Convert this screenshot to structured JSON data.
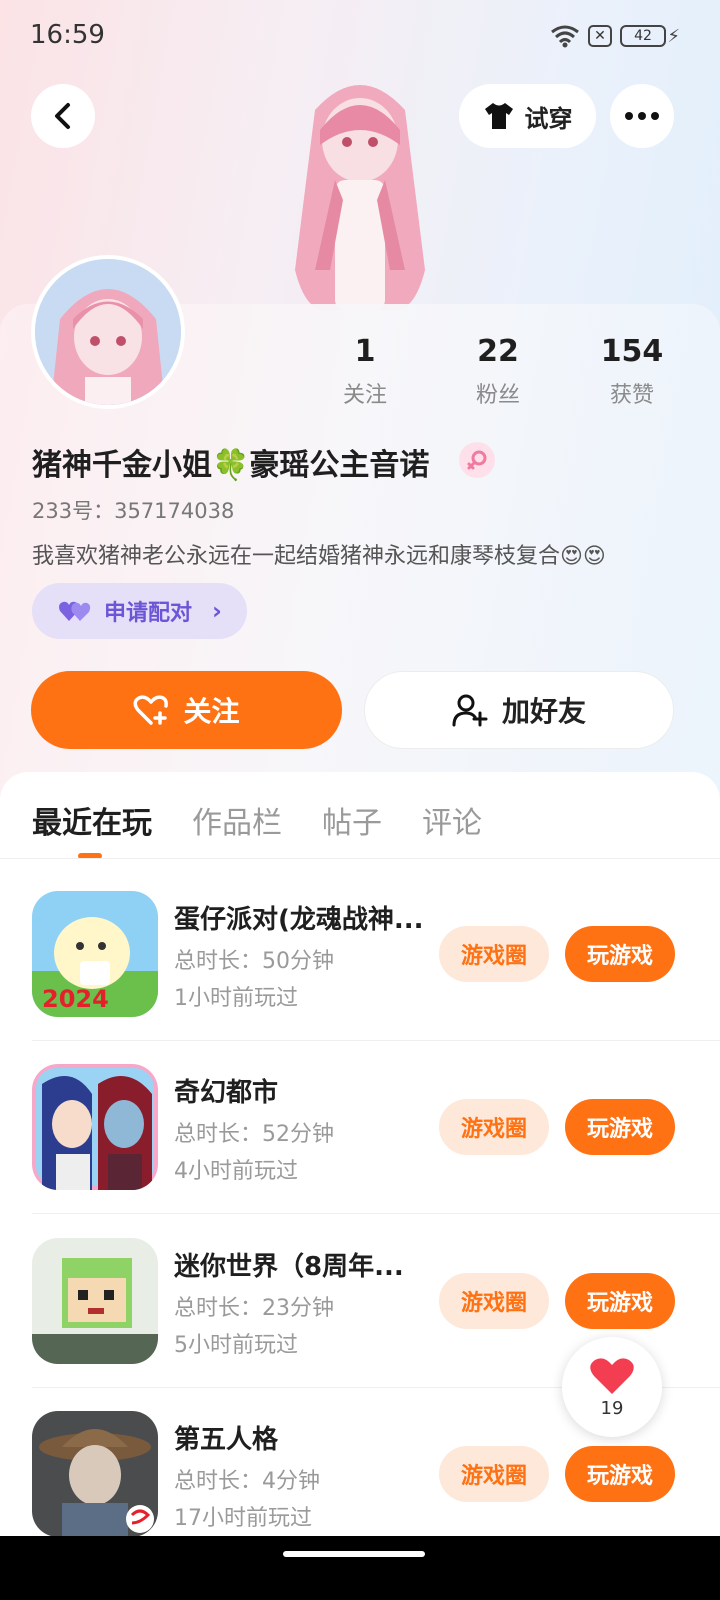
{
  "status_bar": {
    "time": "16:59",
    "battery": "42",
    "battery_alert": "✕"
  },
  "header": {
    "try_on_label": "试穿"
  },
  "profile": {
    "nickname": "猪神千金小姐🍀豪瑶公主音诺",
    "uid": "233号：357174038",
    "bio": "我喜欢猪神老公永远在一起结婚猪神永远和康琴枝复合😍😍",
    "pair_label": "申请配对",
    "stats": [
      {
        "value": "1",
        "label": "关注"
      },
      {
        "value": "22",
        "label": "粉丝"
      },
      {
        "value": "154",
        "label": "获赞"
      }
    ]
  },
  "actions": {
    "follow_label": "关注",
    "add_friend_label": "加好友"
  },
  "tabs": [
    "最近在玩",
    "作品栏",
    "帖子",
    "评论"
  ],
  "games": [
    {
      "title": "蛋仔派对(龙魂战神...",
      "duration": "总时长：50分钟",
      "last_played": "1小时前玩过",
      "icon_text": "2024"
    },
    {
      "title": "奇幻都市",
      "duration": "总时长：52分钟",
      "last_played": "4小时前玩过"
    },
    {
      "title": "迷你世界（8周年...",
      "duration": "总时长：23分钟",
      "last_played": "5小时前玩过"
    },
    {
      "title": "第五人格",
      "duration": "总时长：4分钟",
      "last_played": "17小时前玩过"
    }
  ],
  "game_buttons": {
    "circle_label": "游戏圈",
    "play_label": "玩游戏"
  },
  "like_float": {
    "count": "19"
  },
  "colors": {
    "accent": "#ff7214",
    "pair_purple": "#6c55d6",
    "circle_bg": "#fde8da"
  }
}
